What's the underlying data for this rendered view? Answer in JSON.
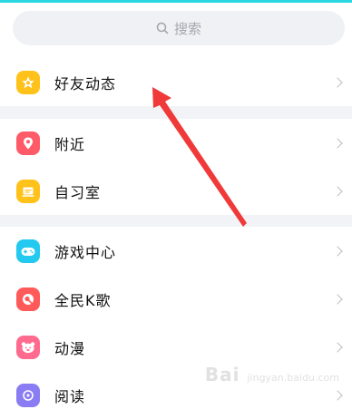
{
  "search": {
    "placeholder": "搜索"
  },
  "groups": [
    {
      "items": [
        {
          "label": "好友动态",
          "icon": "star-icon",
          "color": "#ffc21a"
        }
      ]
    },
    {
      "items": [
        {
          "label": "附近",
          "icon": "location-pin-icon",
          "color": "#ff5a67"
        },
        {
          "label": "自习室",
          "icon": "study-room-icon",
          "color": "#ffc21a"
        }
      ]
    },
    {
      "items": [
        {
          "label": "游戏中心",
          "icon": "gamepad-icon",
          "color": "#23c9ef"
        },
        {
          "label": "全民K歌",
          "icon": "karaoke-icon",
          "color": "#ff5a5a"
        },
        {
          "label": "动漫",
          "icon": "anime-icon",
          "color": "#ff6b8f"
        },
        {
          "label": "阅读",
          "icon": "reading-icon",
          "color": "#8a7cf2"
        }
      ]
    }
  ],
  "watermark": {
    "text": "Bai",
    "sub": "jingyan.baidu.com"
  },
  "colors": {
    "accent": "#2ad7e0",
    "arrow": "#f03a3a"
  }
}
